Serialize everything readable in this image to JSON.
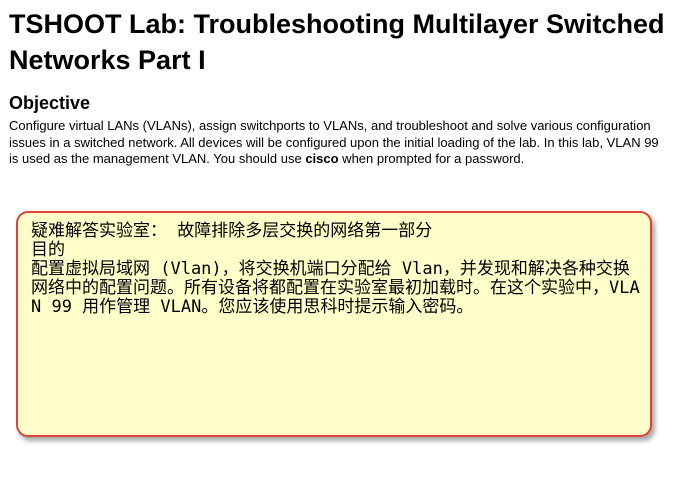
{
  "document": {
    "title": "TSHOOT Lab: Troubleshooting Multilayer Switched Networks Part I",
    "objective_heading": "Objective",
    "objective_text_1": "Configure virtual LANs (VLANs), assign switchports to VLANs, and troubleshoot and solve various configuration issues in a switched network. All devices will be configured upon the initial loading of the lab. In this lab, VLAN 99 is used as the management VLAN. You should use ",
    "objective_password": "cisco",
    "objective_text_2": " when prompted for a password."
  },
  "translation_callout": {
    "title_line": "疑难解答实验室： 故障排除多层交换的网络第一部分",
    "heading_line": "目的",
    "body": "配置虚拟局域网 (Vlan)，将交换机端口分配给 Vlan，并发现和解决各种交换网络中的配置问题。所有设备将都配置在实验室最初加载时。在这个实验中，VLAN 99 用作管理 VLAN。您应该使用思科时提示输入密码。",
    "border_color": "#d8453b",
    "background_color": "#ffffc9"
  }
}
